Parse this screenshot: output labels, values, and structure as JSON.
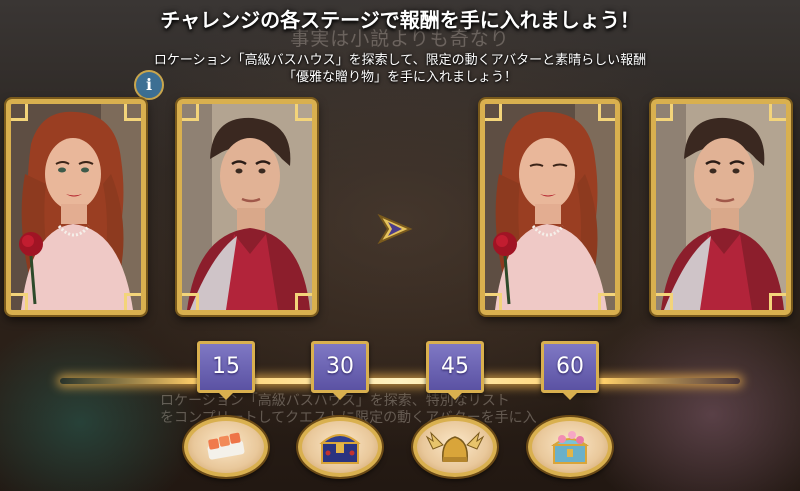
{
  "header": {
    "title": "チャレンジの各ステージで報酬を手に入れましょう！",
    "subtitle_line1": "ロケーション「高級バスハウス」を探索して、限定の動くアバターと素晴らしい報酬",
    "subtitle_line2": "「優雅な贈り物」を手に入れましょう！"
  },
  "background": {
    "ghost_title": "事実は小説よりも奇なり",
    "ghost_text_line1": "ロケーション「高級バスハウス」を探索、特別なリスト",
    "ghost_text_line2": "をコンプリートしてクエストに限定の動くアバターを手に入"
  },
  "info_button": {
    "label": "i"
  },
  "avatars": [
    {
      "name": "woman-avatar"
    },
    {
      "name": "man-avatar"
    },
    {
      "name": "woman-avatar-animated"
    },
    {
      "name": "man-avatar-animated"
    }
  ],
  "stages": [
    {
      "label": "15",
      "reward_icon": "salmon-sushi-icon"
    },
    {
      "label": "30",
      "reward_icon": "treasure-chest-icon"
    },
    {
      "label": "45",
      "reward_icon": "winged-helmet-icon"
    },
    {
      "label": "60",
      "reward_icon": "flower-chest-icon"
    }
  ],
  "colors": {
    "gold_frame": "#d9b04f",
    "badge_purple": "#6a62b4",
    "glow": "#ffcf6a"
  }
}
